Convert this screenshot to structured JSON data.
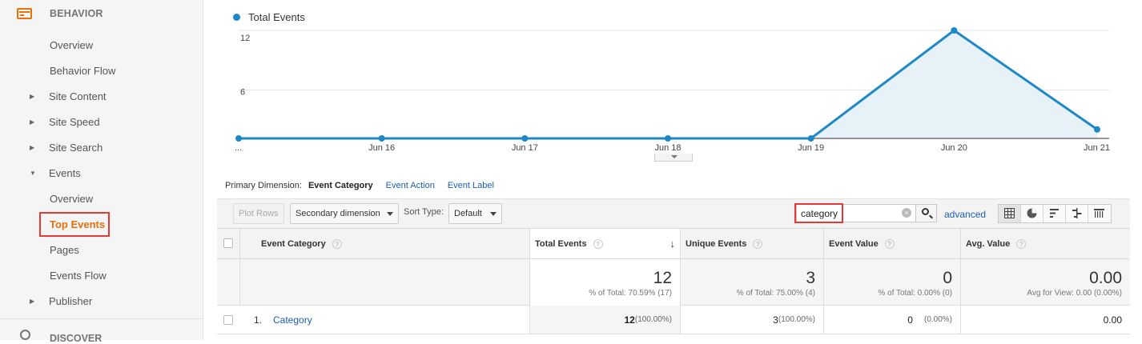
{
  "sidebar": {
    "section_title": "BEHAVIOR",
    "items": [
      {
        "label": "Overview"
      },
      {
        "label": "Behavior Flow"
      },
      {
        "label": "Site Content"
      },
      {
        "label": "Site Speed"
      },
      {
        "label": "Site Search"
      },
      {
        "label": "Events"
      },
      {
        "label": "Overview"
      },
      {
        "label": "Top Events"
      },
      {
        "label": "Pages"
      },
      {
        "label": "Events Flow"
      },
      {
        "label": "Publisher"
      }
    ],
    "discover_label": "DISCOVER"
  },
  "chart_data": {
    "type": "area",
    "series": [
      {
        "name": "Total Events",
        "values": [
          0,
          0,
          0,
          0,
          0,
          12,
          1
        ]
      }
    ],
    "categories": [
      "...",
      "Jun 16",
      "Jun 17",
      "Jun 18",
      "Jun 19",
      "Jun 20",
      "Jun 21"
    ],
    "yticks": [
      "12",
      "6"
    ],
    "ylim": [
      0,
      12
    ],
    "color": "#1e88c7",
    "fill_color": "#e6f1f8",
    "grid": true
  },
  "dimensions": {
    "label": "Primary Dimension:",
    "active": "Event Category",
    "links": [
      "Event Action",
      "Event Label"
    ]
  },
  "toolbar": {
    "plot_rows": "Plot Rows",
    "secondary_dimension": "Secondary dimension",
    "sort_type_label": "Sort Type:",
    "sort_type_value": "Default",
    "search_value": "category",
    "advanced": "advanced"
  },
  "table": {
    "headers": [
      "Event Category",
      "Total Events",
      "Unique Events",
      "Event Value",
      "Avg. Value"
    ],
    "help_glyph": "?",
    "sort_glyph": "↓",
    "totals": [
      {
        "value": "12",
        "sub": "% of Total: 70.59% (17)"
      },
      {
        "value": "3",
        "sub": "% of Total: 75.00% (4)"
      },
      {
        "value": "0",
        "sub": "% of Total: 0.00% (0)"
      },
      {
        "value": "0.00",
        "sub": "Avg for View: 0.00 (0.00%)"
      }
    ],
    "rows": [
      {
        "num": "1.",
        "category": "Category",
        "total_events": "12",
        "total_events_pct": "(100.00%)",
        "unique_events": "3",
        "unique_events_pct": "(100.00%)",
        "event_value": "0",
        "event_value_pct": "(0.00%)",
        "avg_value": "0.00"
      }
    ]
  }
}
